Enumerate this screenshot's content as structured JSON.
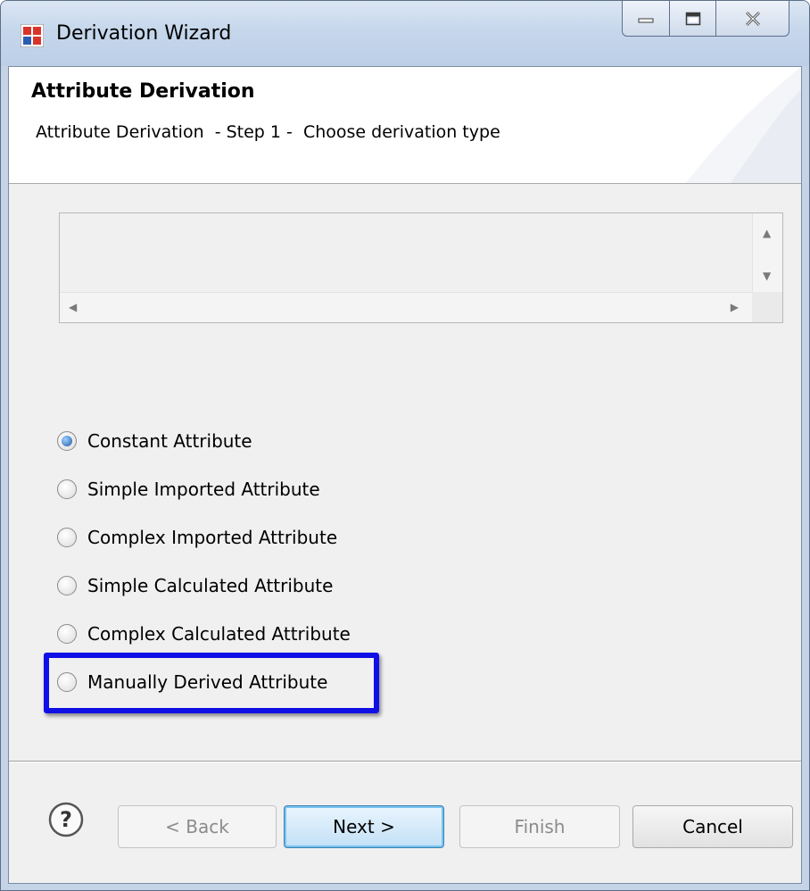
{
  "window": {
    "title": "Derivation Wizard"
  },
  "header": {
    "title": "Attribute Derivation",
    "description": "Attribute Derivation  - Step 1 -  Choose derivation type"
  },
  "options": [
    {
      "label": "Constant Attribute",
      "selected": true
    },
    {
      "label": "Simple Imported Attribute",
      "selected": false
    },
    {
      "label": "Complex Imported Attribute",
      "selected": false
    },
    {
      "label": "Simple Calculated Attribute",
      "selected": false
    },
    {
      "label": "Complex Calculated Attribute",
      "selected": false
    },
    {
      "label": "Manually Derived Attribute",
      "selected": false
    }
  ],
  "buttons": {
    "back": "< Back",
    "next": "Next >",
    "finish": "Finish",
    "cancel": "Cancel"
  },
  "colors": {
    "highlight": "#1010e6",
    "titlebar": "#c6d7ec"
  }
}
